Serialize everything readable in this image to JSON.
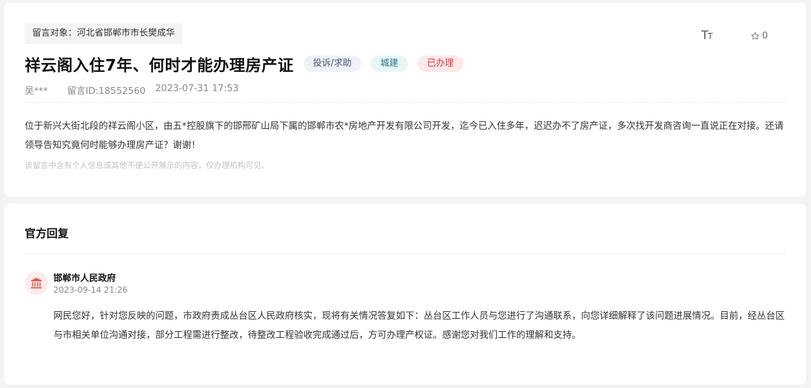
{
  "message": {
    "target": "留言对象：河北省邯郸市市长樊成华",
    "font_toggle": {
      "big": "T",
      "small": "T"
    },
    "favorite_count": "0",
    "title": "祥云阁入住7年、何时才能办理房产证",
    "badges": {
      "type": "投诉/求助",
      "category": "城建",
      "status": "已办理"
    },
    "author": "吴***",
    "message_id": "留言ID:18552560",
    "date": "2023-07-31 17:53",
    "content": "位于新兴大街北段的祥云阁小区，由五*控股旗下的邯邢矿山局下属的邯郸市农*房地产开发有限公司开发，迄今已入住多年，迟迟办不了房产证，多次找开发商咨询一直说正在对接。还请领导告知究竟何时能够办理房产证？谢谢！",
    "privacy_note": "该留言中含有个人信息或其他不便公开展示的内容，仅办理机构可见。"
  },
  "reply": {
    "heading": "官方回复",
    "org_name": "邯郸市人民政府",
    "time": "2023-09-14 21:26",
    "content": "网民您好，针对您反映的问题，市政府责成丛台区人民政府核实，现将有关情况答复如下：丛台区工作人员与您进行了沟通联系，向您详细解释了该问题进展情况。目前，经丛台区与市相关单位沟通对接，部分工程需进行整改，待整改工程验收完成通过后，方可办理产权证。感谢您对我们工作的理解和支持。"
  },
  "colors": {
    "status_red": "#d9363e",
    "org_icon_red": "#e05a5a",
    "category_blue": "#2c6f8f"
  },
  "icons": [
    "font-size-icon",
    "star-icon",
    "government-building-icon"
  ]
}
